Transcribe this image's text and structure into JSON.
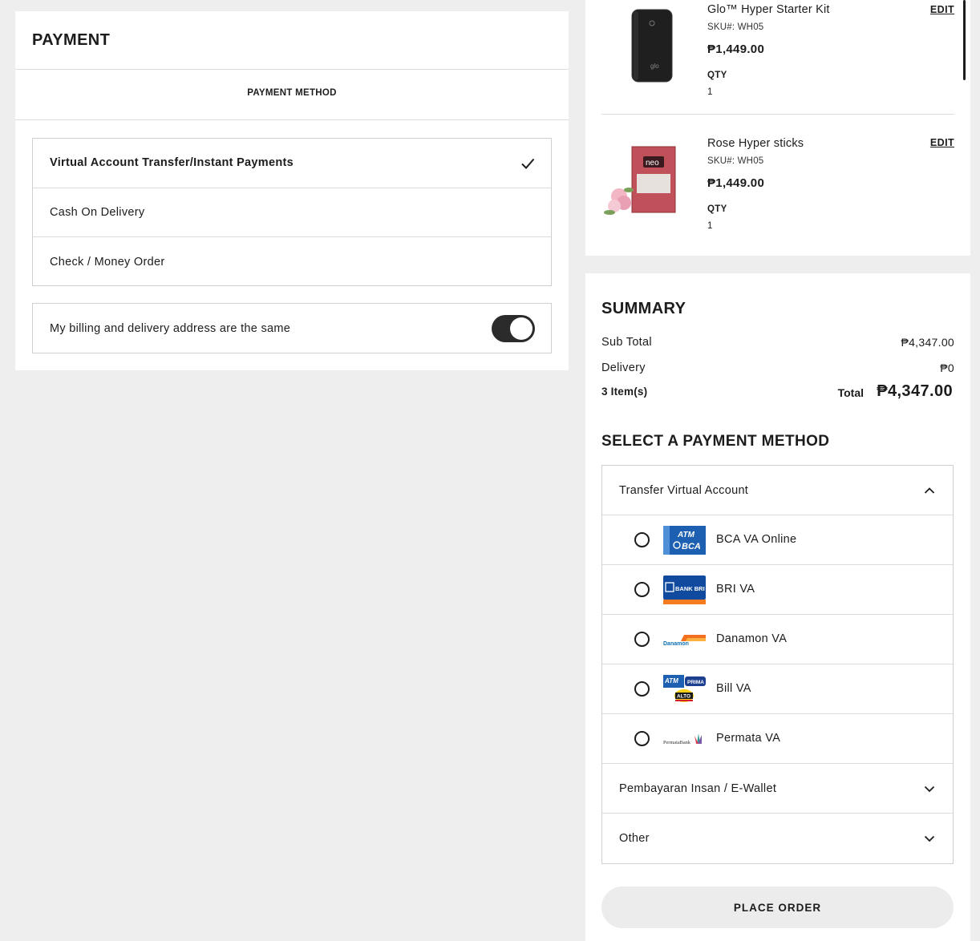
{
  "payment": {
    "title": "PAYMENT",
    "tab_label": "PAYMENT METHOD",
    "options": [
      {
        "label": "Virtual Account Transfer/Instant Payments",
        "selected": true
      },
      {
        "label": "Cash On Delivery",
        "selected": false
      },
      {
        "label": "Check / Money Order",
        "selected": false
      }
    ],
    "same_address_label": "My billing and delivery address are the same",
    "same_address_on": true
  },
  "cart": {
    "items": [
      {
        "name": "Glo™ Hyper Starter Kit",
        "sku": "SKU#: WH05",
        "price": "₱1,449.00",
        "qty_label": "QTY",
        "qty": "1",
        "edit": "EDIT",
        "image": "glo-device-thumbnail"
      },
      {
        "name": "Rose Hyper sticks",
        "sku": "SKU#: WH05",
        "price": "₱1,449.00",
        "qty_label": "QTY",
        "qty": "1",
        "edit": "EDIT",
        "image": "neo-rose-pack-thumbnail"
      }
    ]
  },
  "summary": {
    "title": "SUMMARY",
    "subtotal_label": "Sub Total",
    "subtotal": "₱4,347.00",
    "delivery_label": "Delivery",
    "delivery": "₱0",
    "item_count": "3 Item(s)",
    "total_label": "Total",
    "total": "₱4,347.00"
  },
  "payment_methods": {
    "title": "SELECT A PAYMENT METHOD",
    "groups": [
      {
        "label": "Transfer Virtual Account",
        "expanded": true,
        "icon": "chevron-up-icon"
      },
      {
        "label": "Pembayaran Insan / E-Wallet",
        "expanded": false,
        "icon": "chevron-down-icon"
      },
      {
        "label": "Other",
        "expanded": false,
        "icon": "chevron-down-icon"
      }
    ],
    "banks": [
      {
        "name": "BCA VA Online",
        "logo": "atm-bca-logo",
        "logo_text": "ATM BCA"
      },
      {
        "name": "BRI VA",
        "logo": "bank-bri-logo",
        "logo_text": "BANK BRI"
      },
      {
        "name": "Danamon VA",
        "logo": "danamon-logo",
        "logo_text": "Danamon"
      },
      {
        "name": "Bill VA",
        "logo": "atm-bersama-prima-alto-logo",
        "logo_text": "ATM PRIMA ALTO"
      },
      {
        "name": "Permata VA",
        "logo": "permata-bank-logo",
        "logo_text": "PermataBank"
      }
    ]
  },
  "place_order_label": "PLACE ORDER",
  "colors": {
    "accent": "#1c1c1c",
    "background": "#eeeeee",
    "button": "#ececec"
  }
}
